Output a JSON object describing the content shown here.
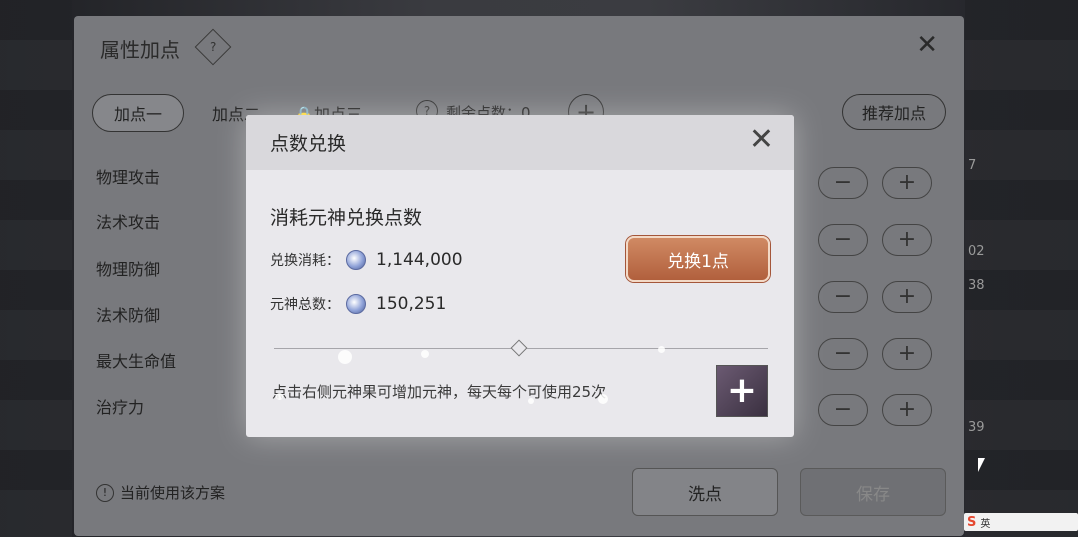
{
  "background": {
    "right_numbers": [
      "7",
      "02",
      "38",
      "39"
    ]
  },
  "attr_window": {
    "title": "属性加点",
    "help_icon": "?",
    "close_icon": "✕",
    "tabs": [
      {
        "label": "加点一",
        "active": true
      },
      {
        "label": "加点二",
        "active": false
      },
      {
        "label": "🔒加点三",
        "active": false
      }
    ],
    "remain_help": "?",
    "remain_label": "剩余点数：0",
    "add_points_icon": "+",
    "recommend_label": "推荐加点",
    "stats": [
      "物理攻击",
      "法术攻击",
      "物理防御",
      "法术防御",
      "最大生命值",
      "治疗力"
    ],
    "minus_icon": "−",
    "plus_icon": "+",
    "current_plan_label": "当前使用该方案",
    "current_plan_icon": "!",
    "wash_label": "洗点",
    "save_label": "保存"
  },
  "modal": {
    "title": "点数兑换",
    "close_icon": "✕",
    "subtitle": "消耗元神兑换点数",
    "cost_label": "兑换消耗：",
    "cost_value": "1,144,000",
    "total_label": "元神总数：",
    "total_value": "150,251",
    "exchange_button": "兑换1点",
    "tip": "点击右侧元神果可增加元神，每天每个可使用25次",
    "fruit_icon": "+",
    "colors": {
      "exchange_button": "#c2724c",
      "panel": "#e9e8ec"
    }
  },
  "taskbar": {
    "ime_logo": "S",
    "ime_lang": "英"
  }
}
